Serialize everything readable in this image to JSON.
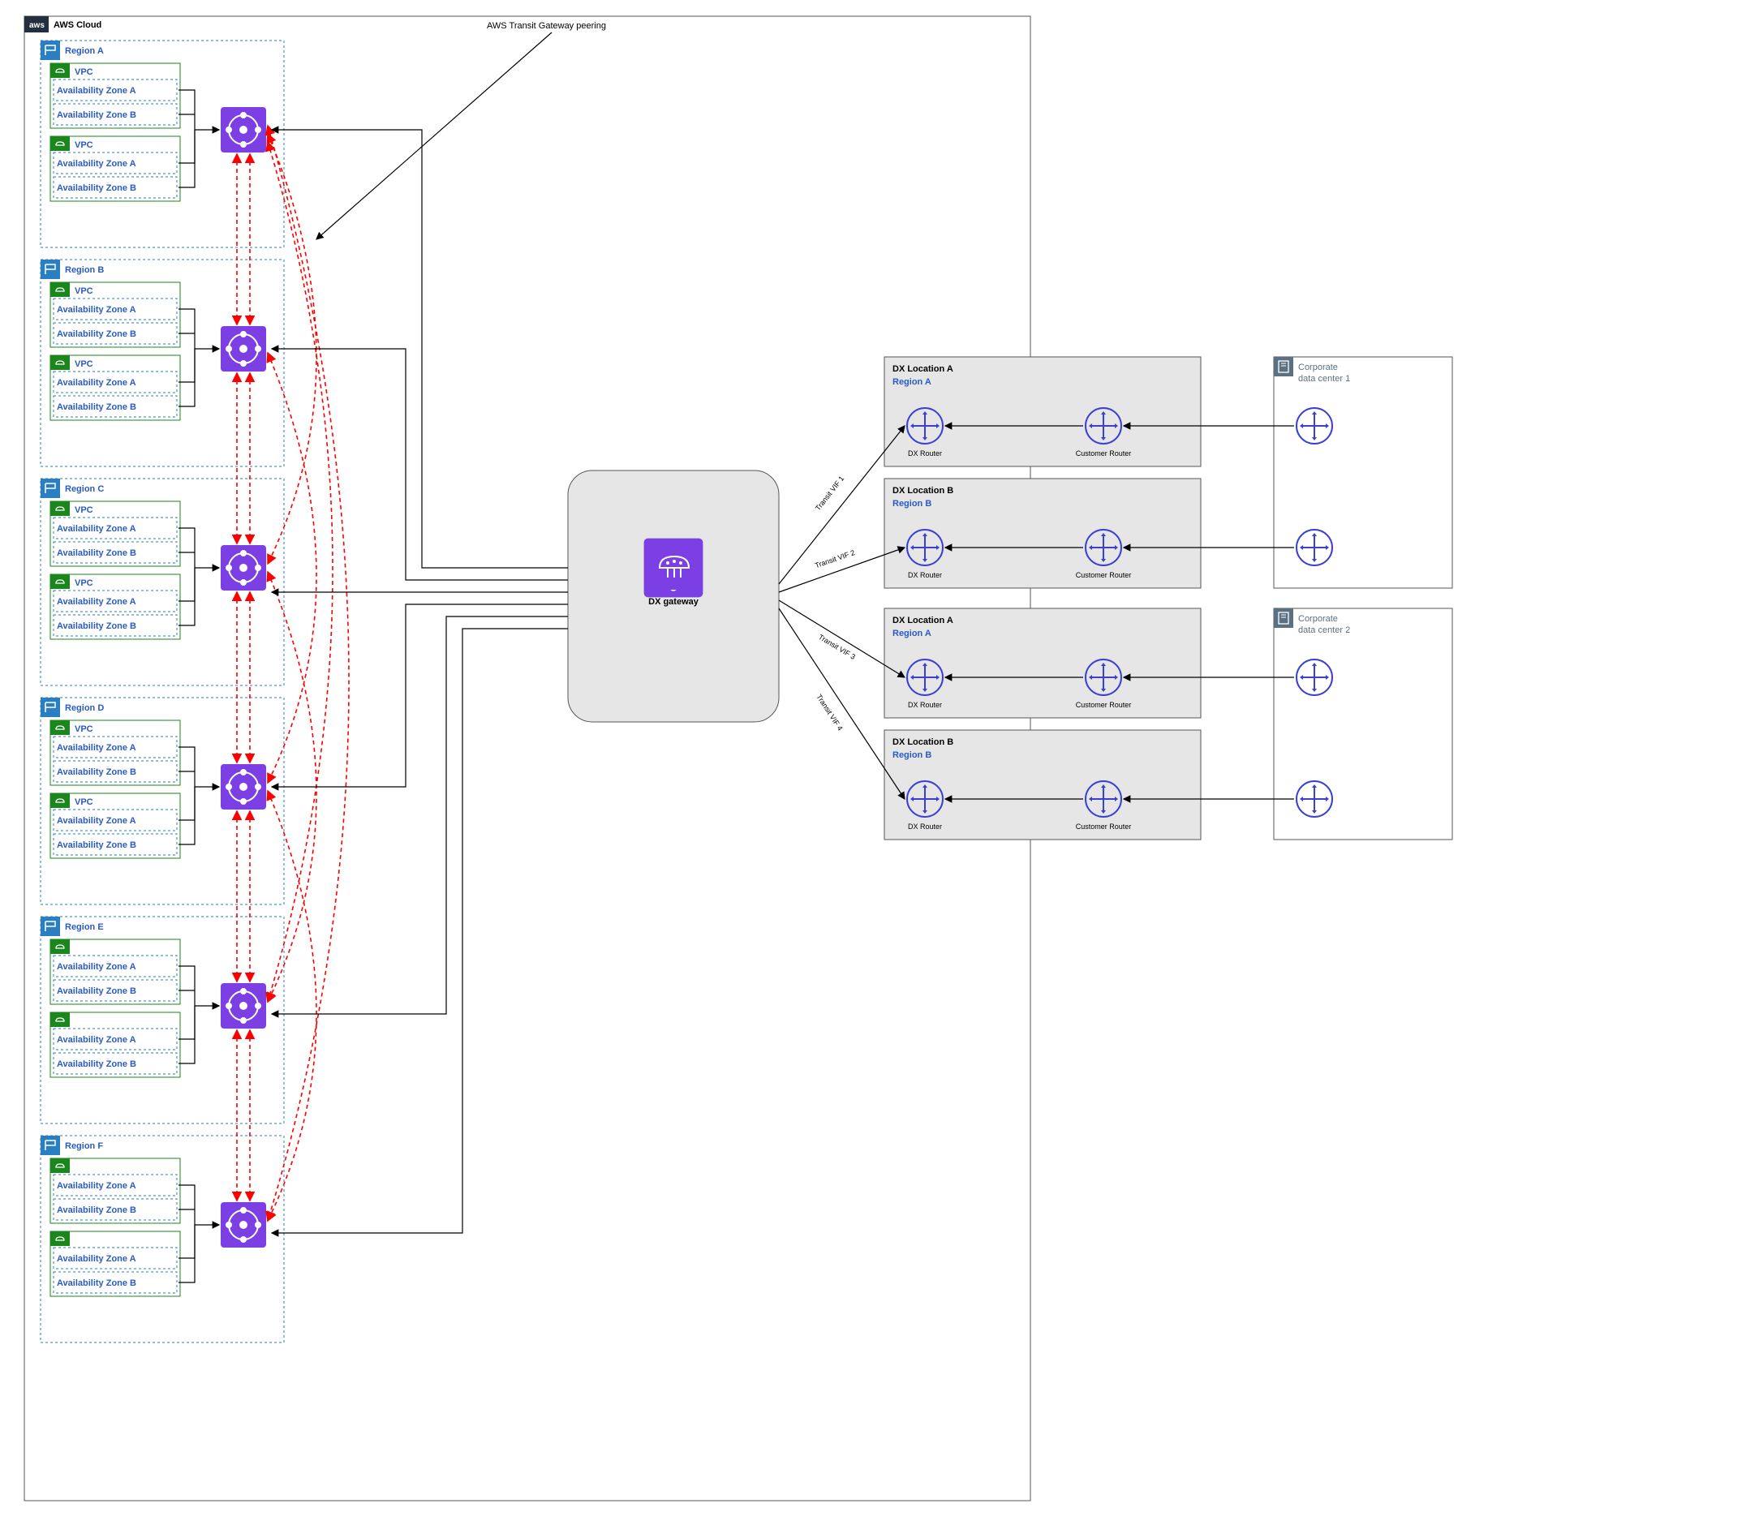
{
  "title": "AWS Cloud",
  "peering_label": "AWS Transit Gateway peering",
  "dx_gateway_label": "DX gateway",
  "regions": [
    {
      "name": "Region A",
      "vpcs": [
        {
          "label": "VPC",
          "azs": [
            "Availability Zone A",
            "Availability Zone B"
          ]
        },
        {
          "label": "VPC",
          "azs": [
            "Availability Zone A",
            "Availability Zone B"
          ]
        }
      ]
    },
    {
      "name": "Region B",
      "vpcs": [
        {
          "label": "VPC",
          "azs": [
            "Availability Zone A",
            "Availability Zone B"
          ]
        },
        {
          "label": "VPC",
          "azs": [
            "Availability Zone A",
            "Availability Zone B"
          ]
        }
      ]
    },
    {
      "name": "Region C",
      "vpcs": [
        {
          "label": "VPC",
          "azs": [
            "Availability Zone A",
            "Availability Zone B"
          ]
        },
        {
          "label": "VPC",
          "azs": [
            "Availability Zone A",
            "Availability Zone B"
          ]
        }
      ]
    },
    {
      "name": "Region D",
      "vpcs": [
        {
          "label": "VPC",
          "azs": [
            "Availability Zone A",
            "Availability Zone B"
          ]
        },
        {
          "label": "VPC",
          "azs": [
            "Availability Zone A",
            "Availability Zone B"
          ]
        }
      ]
    },
    {
      "name": "Region E",
      "vpcs": [
        {
          "label": "",
          "azs": [
            "Availability Zone A",
            "Availability Zone B"
          ]
        },
        {
          "label": "",
          "azs": [
            "Availability Zone A",
            "Availability Zone B"
          ]
        }
      ]
    },
    {
      "name": "Region F",
      "vpcs": [
        {
          "label": "",
          "azs": [
            "Availability Zone A",
            "Availability Zone B"
          ]
        },
        {
          "label": "",
          "azs": [
            "Availability Zone A",
            "Availability Zone B"
          ]
        }
      ]
    }
  ],
  "transit_vifs": [
    "Transit VIF 1",
    "Transit VIF 2",
    "Transit VIF 3",
    "Transit VIF 4"
  ],
  "dx_locations": [
    {
      "title": "DX Location A",
      "region": "Region A",
      "dx_router": "DX Router",
      "cust_router": "Customer Router"
    },
    {
      "title": "DX Location B",
      "region": "Region B",
      "dx_router": "DX Router",
      "cust_router": "Customer Router"
    },
    {
      "title": "DX Location A",
      "region": "Region A",
      "dx_router": "DX Router",
      "cust_router": "Customer Router"
    },
    {
      "title": "DX Location B",
      "region": "Region B",
      "dx_router": "DX Router",
      "cust_router": "Customer Router"
    }
  ],
  "data_centers": [
    {
      "line1": "Corporate",
      "line2": "data center 1"
    },
    {
      "line1": "Corporate",
      "line2": "data center 2"
    }
  ]
}
